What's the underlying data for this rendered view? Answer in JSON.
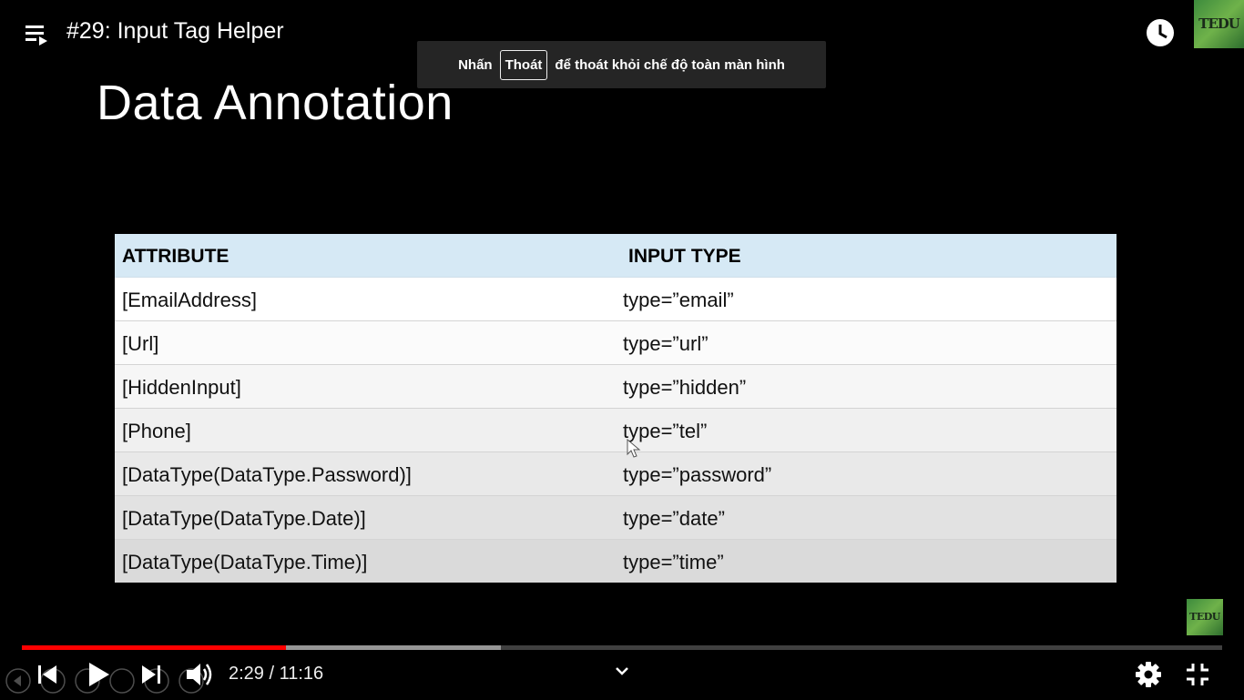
{
  "video": {
    "title": "#29: Input Tag Helper",
    "channel_logo_text": "TEDU"
  },
  "toast": {
    "prefix": "Nhấn",
    "key": "Thoát",
    "suffix": "để thoát khỏi chế độ toàn màn hình"
  },
  "slide": {
    "heading": "Data Annotation",
    "table": {
      "headers": [
        "ATTRIBUTE",
        "INPUT TYPE"
      ],
      "rows": [
        [
          "[EmailAddress]",
          "type=”email”"
        ],
        [
          "[Url]",
          "type=”url”"
        ],
        [
          "[HiddenInput]",
          "type=”hidden”"
        ],
        [
          "[Phone]",
          "type=”tel”"
        ],
        [
          "[DataType(DataType.Password)]",
          "type=”password”"
        ],
        [
          "[DataType(DataType.Date)]",
          "type=”date”"
        ],
        [
          "[DataType(DataType.Time)]",
          "type=”time”"
        ]
      ]
    }
  },
  "player": {
    "current_time": "2:29",
    "separator": "/",
    "duration": "11:16",
    "time_label": "2:29 / 11:16",
    "progress_fraction": 0.22,
    "buffer_fraction": 0.399,
    "played_color": "#ff0000"
  },
  "icons": [
    "playlist-icon",
    "watch-later-icon",
    "share-icon",
    "previous-icon",
    "play-icon",
    "next-icon",
    "volume-icon",
    "chevron-down-icon",
    "settings-icon",
    "exit-fullscreen-icon"
  ]
}
